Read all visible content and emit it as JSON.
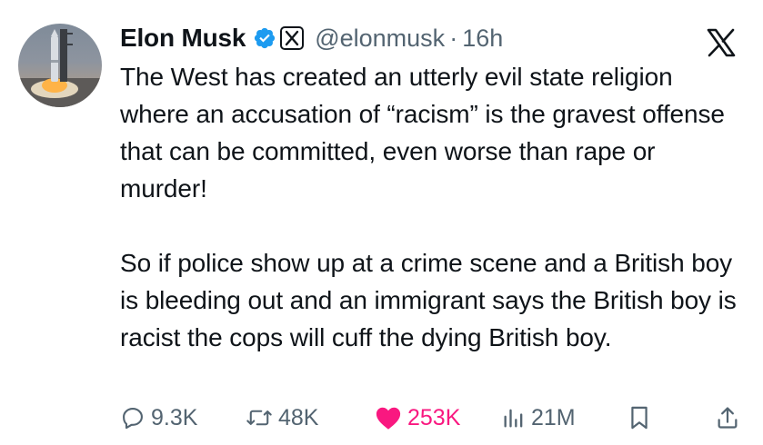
{
  "author": {
    "name": "Elon Musk",
    "handle": "@elonmusk",
    "separator": "·",
    "time": "16h",
    "avatar_icon": "rocket-launch-avatar",
    "verified_color": "#1d9bf0"
  },
  "tweet": {
    "paragraphs": [
      "The West has created an utterly evil state religion where an accusation of “racism” is the gravest offense that can be committed, even worse than rape or murder!",
      "So if police show up at a crime scene and a British boy is bleeding out and an immigrant says the British boy is racist the cops will cuff the dying British boy."
    ]
  },
  "actions": {
    "replies": "9.3K",
    "reposts": "48K",
    "likes": "253K",
    "views": "21M",
    "like_color": "#f91880"
  }
}
